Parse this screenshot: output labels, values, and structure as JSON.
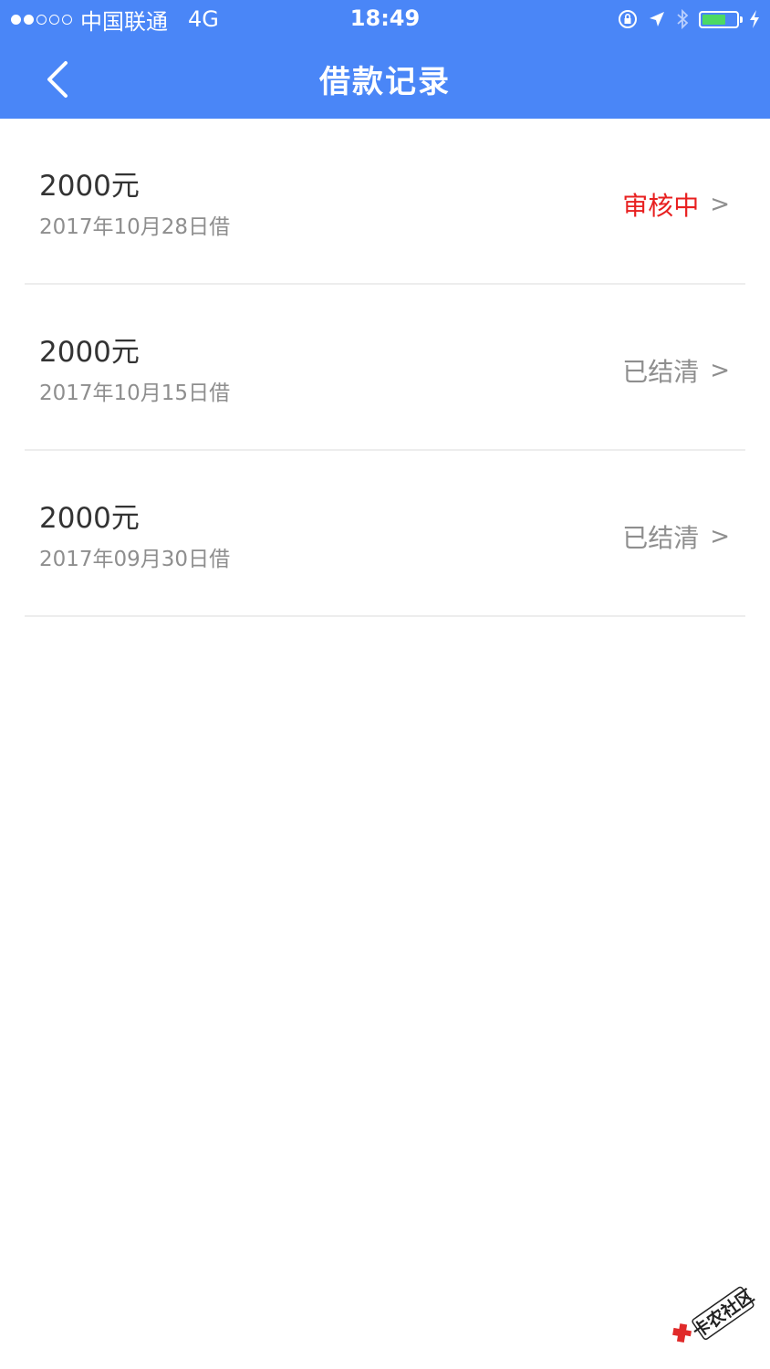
{
  "colors": {
    "brand": "#4a86f7",
    "pending": "#e82020",
    "settled": "#8e8e8e",
    "battery": "#4cd964"
  },
  "status_bar": {
    "signal_dots_filled": 2,
    "signal_dots_total": 5,
    "carrier": "中国联通",
    "network": "4G",
    "time": "18:49",
    "battery_level": 0.7,
    "icons": [
      "rotation-lock-icon",
      "location-arrow-icon",
      "bluetooth-icon",
      "battery-icon",
      "charging-bolt-icon"
    ]
  },
  "nav": {
    "back_icon": "chevron-left-icon",
    "title": "借款记录"
  },
  "records": [
    {
      "amount": "2000元",
      "date": "2017年10月28日借",
      "status": "审核中",
      "status_type": "pending",
      "chevron": ">"
    },
    {
      "amount": "2000元",
      "date": "2017年10月15日借",
      "status": "已结清",
      "status_type": "settled",
      "chevron": ">"
    },
    {
      "amount": "2000元",
      "date": "2017年09月30日借",
      "status": "已结清",
      "status_type": "settled",
      "chevron": ">"
    }
  ],
  "watermark": {
    "text": "卡农社区",
    "icon": "watermark-logo-icon"
  }
}
